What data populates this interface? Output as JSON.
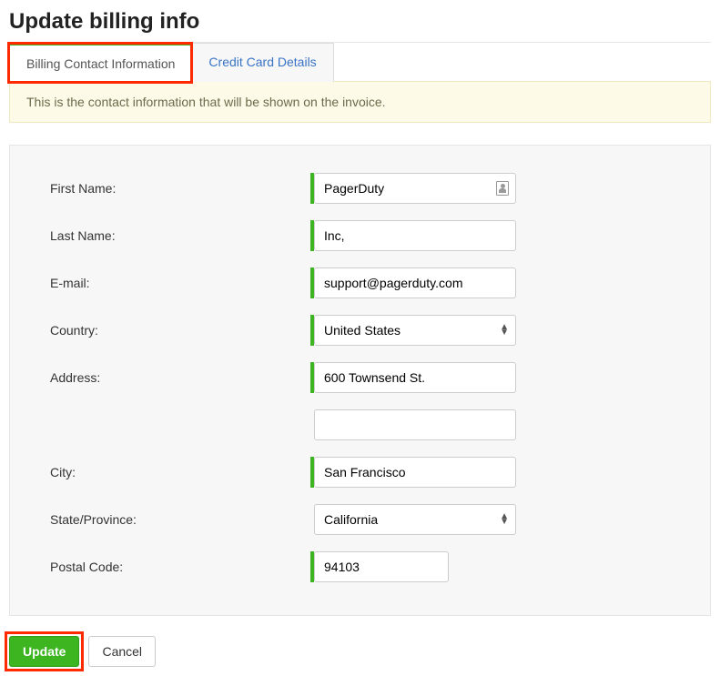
{
  "page": {
    "title": "Update billing info"
  },
  "tabs": {
    "billing": "Billing Contact Information",
    "credit": "Credit Card Details"
  },
  "banner": {
    "text": "This is the contact information that will be shown on the invoice."
  },
  "form": {
    "first_name": {
      "label": "First Name:",
      "value": "PagerDuty"
    },
    "last_name": {
      "label": "Last Name:",
      "value": "Inc,"
    },
    "email": {
      "label": "E-mail:",
      "value": "support@pagerduty.com"
    },
    "country": {
      "label": "Country:",
      "value": "United States"
    },
    "address": {
      "label": "Address:",
      "value": "600 Townsend St."
    },
    "address2": {
      "value": ""
    },
    "city": {
      "label": "City:",
      "value": "San Francisco"
    },
    "state": {
      "label": "State/Province:",
      "value": "California"
    },
    "postal": {
      "label": "Postal Code:",
      "value": "94103"
    }
  },
  "actions": {
    "update": "Update",
    "cancel": "Cancel"
  }
}
